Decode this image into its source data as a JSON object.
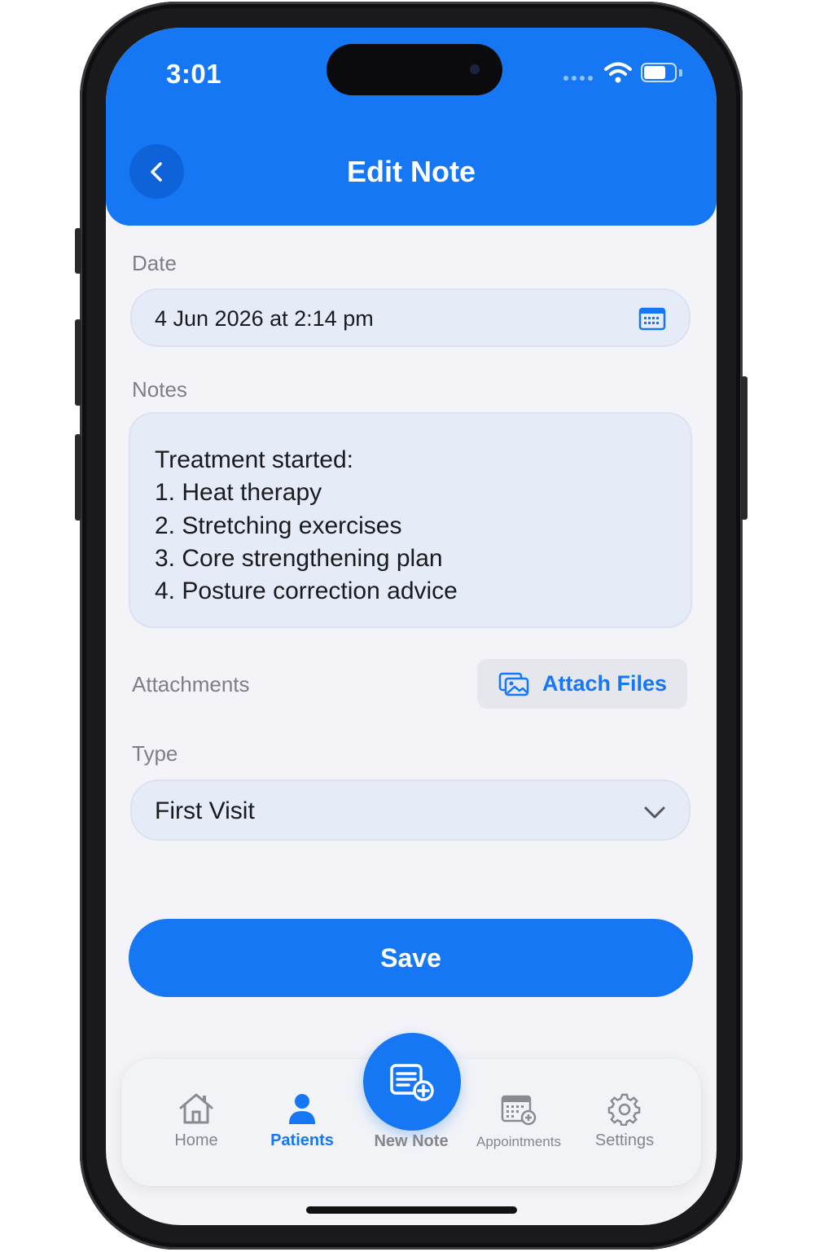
{
  "status_bar": {
    "time": "3:01"
  },
  "header": {
    "title": "Edit Note"
  },
  "form": {
    "date_label": "Date",
    "date_value": "4 Jun 2026 at 2:14 pm",
    "notes_label": "Notes",
    "notes_lines": [
      "Treatment started:",
      "1. Heat therapy",
      "2. Stretching exercises",
      "3. Core strengthening plan",
      "4. Posture correction advice"
    ],
    "attachments_label": "Attachments",
    "attach_button": "Attach Files",
    "type_label": "Type",
    "type_value": "First Visit"
  },
  "save_button": "Save",
  "tabbar": {
    "tabs": [
      {
        "label": "Home",
        "icon": "house-icon",
        "active": false
      },
      {
        "label": "Patients",
        "icon": "person-icon",
        "active": true
      },
      {
        "label": "New Note",
        "icon": "note-add-icon",
        "active": false
      },
      {
        "label": "Appointments",
        "icon": "calendar-add-icon",
        "active": false
      },
      {
        "label": "Settings",
        "icon": "gear-icon",
        "active": false
      }
    ]
  },
  "colors": {
    "accent": "#1677f5",
    "background": "#f4f4f8",
    "field_bg": "#e6ebf8",
    "muted_text": "#7e7f86"
  }
}
